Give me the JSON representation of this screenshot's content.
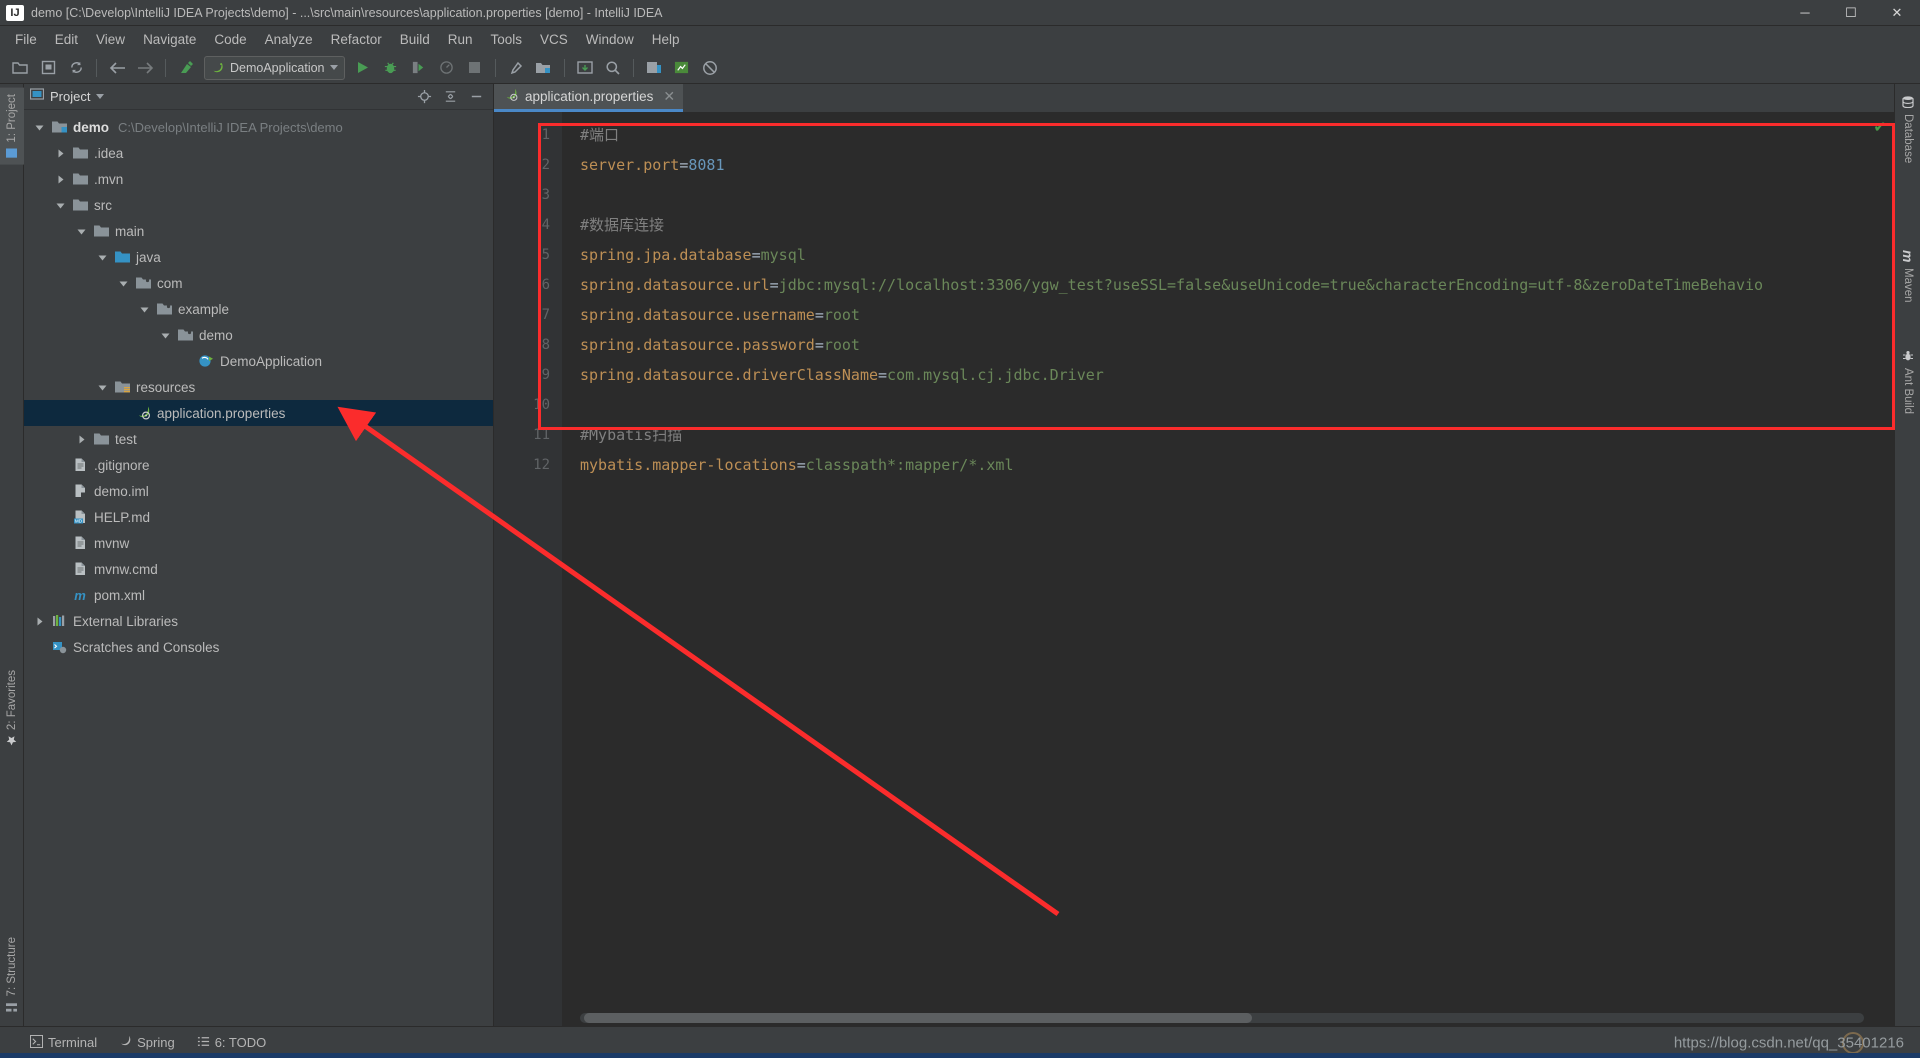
{
  "window": {
    "title": "demo [C:\\Develop\\IntelliJ IDEA Projects\\demo] - ...\\src\\main\\resources\\application.properties [demo] - IntelliJ IDEA",
    "logo_text": "IJ",
    "minimize": "─",
    "maximize": "☐",
    "close": "✕"
  },
  "menubar": [
    {
      "label": "File"
    },
    {
      "label": "Edit"
    },
    {
      "label": "View"
    },
    {
      "label": "Navigate"
    },
    {
      "label": "Code"
    },
    {
      "label": "Analyze"
    },
    {
      "label": "Refactor"
    },
    {
      "label": "Build"
    },
    {
      "label": "Run"
    },
    {
      "label": "Tools"
    },
    {
      "label": "VCS"
    },
    {
      "label": "Window"
    },
    {
      "label": "Help"
    }
  ],
  "toolbar": {
    "run_config": "DemoApplication",
    "icons": [
      "open-project-icon",
      "save-all-icon",
      "sync-icon",
      "back-icon",
      "forward-icon",
      "build-icon",
      "run-icon",
      "debug-icon",
      "run-with-coverage-icon",
      "profile-icon",
      "stop-icon",
      "settings-icon",
      "project-structure-icon",
      "update-project-icon",
      "search-everywhere-icon",
      "commit-icon",
      "database-icon",
      "disabled-icon"
    ]
  },
  "left_rail": [
    {
      "label": "1: Project",
      "icon": "project-tool-icon",
      "selected": true
    },
    {
      "label": "2: Favorites",
      "icon": "star-icon",
      "selected": false
    },
    {
      "label": "7: Structure",
      "icon": "structure-icon",
      "selected": false
    }
  ],
  "right_rail": [
    {
      "label": "Database",
      "icon": "database-icon"
    },
    {
      "label": "Maven",
      "icon": "maven-icon"
    },
    {
      "label": "Ant Build",
      "icon": "ant-icon"
    }
  ],
  "project_panel": {
    "title": "Project",
    "dropdown_icon": "chevron-down-icon",
    "actions": [
      "locate-icon",
      "collapse-all-icon",
      "hide-icon"
    ],
    "tree": [
      {
        "indent": 0,
        "arrow": "down",
        "icon": "module-folder-icon",
        "label": "demo",
        "sub": "C:\\Develop\\IntelliJ IDEA Projects\\demo",
        "bold": true,
        "selected": false
      },
      {
        "indent": 1,
        "arrow": "right",
        "icon": "folder-icon",
        "label": ".idea",
        "sub": "",
        "bold": false,
        "selected": false
      },
      {
        "indent": 1,
        "arrow": "right",
        "icon": "folder-icon",
        "label": ".mvn",
        "sub": "",
        "bold": false,
        "selected": false
      },
      {
        "indent": 1,
        "arrow": "down",
        "icon": "folder-icon",
        "label": "src",
        "sub": "",
        "bold": false,
        "selected": false
      },
      {
        "indent": 2,
        "arrow": "down",
        "icon": "folder-icon",
        "label": "main",
        "sub": "",
        "bold": false,
        "selected": false
      },
      {
        "indent": 3,
        "arrow": "down",
        "icon": "source-folder-icon",
        "label": "java",
        "sub": "",
        "bold": false,
        "selected": false
      },
      {
        "indent": 4,
        "arrow": "down",
        "icon": "package-icon",
        "label": "com",
        "sub": "",
        "bold": false,
        "selected": false
      },
      {
        "indent": 5,
        "arrow": "down",
        "icon": "package-icon",
        "label": "example",
        "sub": "",
        "bold": false,
        "selected": false
      },
      {
        "indent": 6,
        "arrow": "down",
        "icon": "package-icon",
        "label": "demo",
        "sub": "",
        "bold": false,
        "selected": false
      },
      {
        "indent": 7,
        "arrow": "none",
        "icon": "spring-class-icon",
        "label": "DemoApplication",
        "sub": "",
        "bold": false,
        "selected": false
      },
      {
        "indent": 3,
        "arrow": "down",
        "icon": "resources-folder-icon",
        "label": "resources",
        "sub": "",
        "bold": false,
        "selected": false
      },
      {
        "indent": 4,
        "arrow": "none",
        "icon": "spring-properties-icon",
        "label": "application.properties",
        "sub": "",
        "bold": false,
        "selected": true
      },
      {
        "indent": 2,
        "arrow": "right",
        "icon": "folder-icon",
        "label": "test",
        "sub": "",
        "bold": false,
        "selected": false
      },
      {
        "indent": 1,
        "arrow": "none",
        "icon": "file-icon",
        "label": ".gitignore",
        "sub": "",
        "bold": false,
        "selected": false
      },
      {
        "indent": 1,
        "arrow": "none",
        "icon": "iml-file-icon",
        "label": "demo.iml",
        "sub": "",
        "bold": false,
        "selected": false
      },
      {
        "indent": 1,
        "arrow": "none",
        "icon": "markdown-file-icon",
        "label": "HELP.md",
        "sub": "",
        "bold": false,
        "selected": false
      },
      {
        "indent": 1,
        "arrow": "none",
        "icon": "file-icon",
        "label": "mvnw",
        "sub": "",
        "bold": false,
        "selected": false
      },
      {
        "indent": 1,
        "arrow": "none",
        "icon": "file-icon",
        "label": "mvnw.cmd",
        "sub": "",
        "bold": false,
        "selected": false
      },
      {
        "indent": 1,
        "arrow": "none",
        "icon": "maven-pom-icon",
        "label": "pom.xml",
        "sub": "",
        "bold": false,
        "selected": false
      },
      {
        "indent": 0,
        "arrow": "right",
        "icon": "libraries-icon",
        "label": "External Libraries",
        "sub": "",
        "bold": false,
        "selected": false
      },
      {
        "indent": 0,
        "arrow": "none",
        "icon": "scratches-icon",
        "label": "Scratches and Consoles",
        "sub": "",
        "bold": false,
        "selected": false
      }
    ]
  },
  "editor": {
    "tab": {
      "label": "application.properties",
      "icon": "spring-properties-icon",
      "close": "✕"
    },
    "inspection_status": "✔",
    "line_numbers": [
      "1",
      "2",
      "3",
      "4",
      "5",
      "6",
      "7",
      "8",
      "9",
      "10",
      "11",
      "12"
    ],
    "lines": [
      {
        "n": 1,
        "type": "comment",
        "text": "#端口"
      },
      {
        "n": 2,
        "type": "prop",
        "key": "server.port",
        "value": "8081",
        "value_kind": "number"
      },
      {
        "n": 3,
        "type": "blank",
        "text": ""
      },
      {
        "n": 4,
        "type": "comment",
        "text": "#数据库连接"
      },
      {
        "n": 5,
        "type": "prop",
        "key": "spring.jpa.database",
        "value": "mysql",
        "value_kind": "string"
      },
      {
        "n": 6,
        "type": "prop",
        "key": "spring.datasource.url",
        "value": "jdbc:mysql://localhost:3306/ygw_test?useSSL=false&useUnicode=true&characterEncoding=utf-8&zeroDateTimeBehavio",
        "value_kind": "string"
      },
      {
        "n": 7,
        "type": "prop",
        "key": "spring.datasource.username",
        "value": "root",
        "value_kind": "string"
      },
      {
        "n": 8,
        "type": "prop",
        "key": "spring.datasource.password",
        "value": "root",
        "value_kind": "string"
      },
      {
        "n": 9,
        "type": "prop",
        "key": "spring.datasource.driverClassName",
        "value": "com.mysql.cj.jdbc.Driver",
        "value_kind": "string"
      },
      {
        "n": 10,
        "type": "blank",
        "text": ""
      },
      {
        "n": 11,
        "type": "comment",
        "text": "#Mybatis扫描"
      },
      {
        "n": 12,
        "type": "prop",
        "key": "mybatis.mapper-locations",
        "value": "classpath*:mapper/*.xml",
        "value_kind": "string"
      }
    ]
  },
  "status_bar": {
    "items": [
      {
        "label": "Terminal",
        "icon": "terminal-icon"
      },
      {
        "label": "Spring",
        "icon": "spring-icon"
      },
      {
        "label": "6: TODO",
        "icon": "todo-icon"
      }
    ],
    "watermark": "https://blog.csdn.net/qq_35401216"
  },
  "colors": {
    "accent": "#4a88c7",
    "annotation_red": "#fb2c2c",
    "selection": "#0d293e",
    "key": "#bd8f55",
    "value": "#6a8759",
    "number": "#6897bb",
    "comment": "#808080",
    "editor_bg": "#2b2b2b",
    "chrome_bg": "#3c3f41"
  }
}
